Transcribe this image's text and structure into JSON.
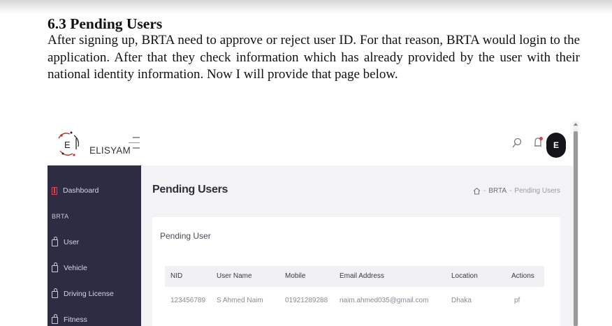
{
  "document": {
    "heading": "6.3 Pending Users",
    "lines": [
      "After signing up, BRTA need to approve or reject user ID. For that reason, BRTA would login",
      "to the application. After that they check information which has already provided by the user",
      "with their national identity information. Now I will provide that page below."
    ]
  },
  "app": {
    "logo_letter": "E",
    "brand": "ELISYAM",
    "avatar_initial": "E",
    "sidebar": {
      "dashboard": "Dashboard",
      "section": "BRTA",
      "items": [
        "User",
        "Vehicle",
        "Driving License",
        "Fitness"
      ]
    },
    "page_title": "Pending Users",
    "breadcrumb": {
      "root": "BRTA",
      "sep": "-",
      "current": "Pending Users"
    },
    "card_title": "Pending User",
    "table": {
      "columns": [
        "NID",
        "User Name",
        "Mobile",
        "Email Address",
        "Location",
        "Actions"
      ],
      "rows": [
        [
          "123456789",
          "S Ahmed Naim",
          "01921289288",
          "naim.ahmed035@gmail.com",
          "Dhaka",
          "pf"
        ]
      ]
    },
    "colors": {
      "sidebar": "#2e2c43",
      "dashboard_icon": "#e2434b",
      "content_bg": "#f3f3f5"
    }
  }
}
